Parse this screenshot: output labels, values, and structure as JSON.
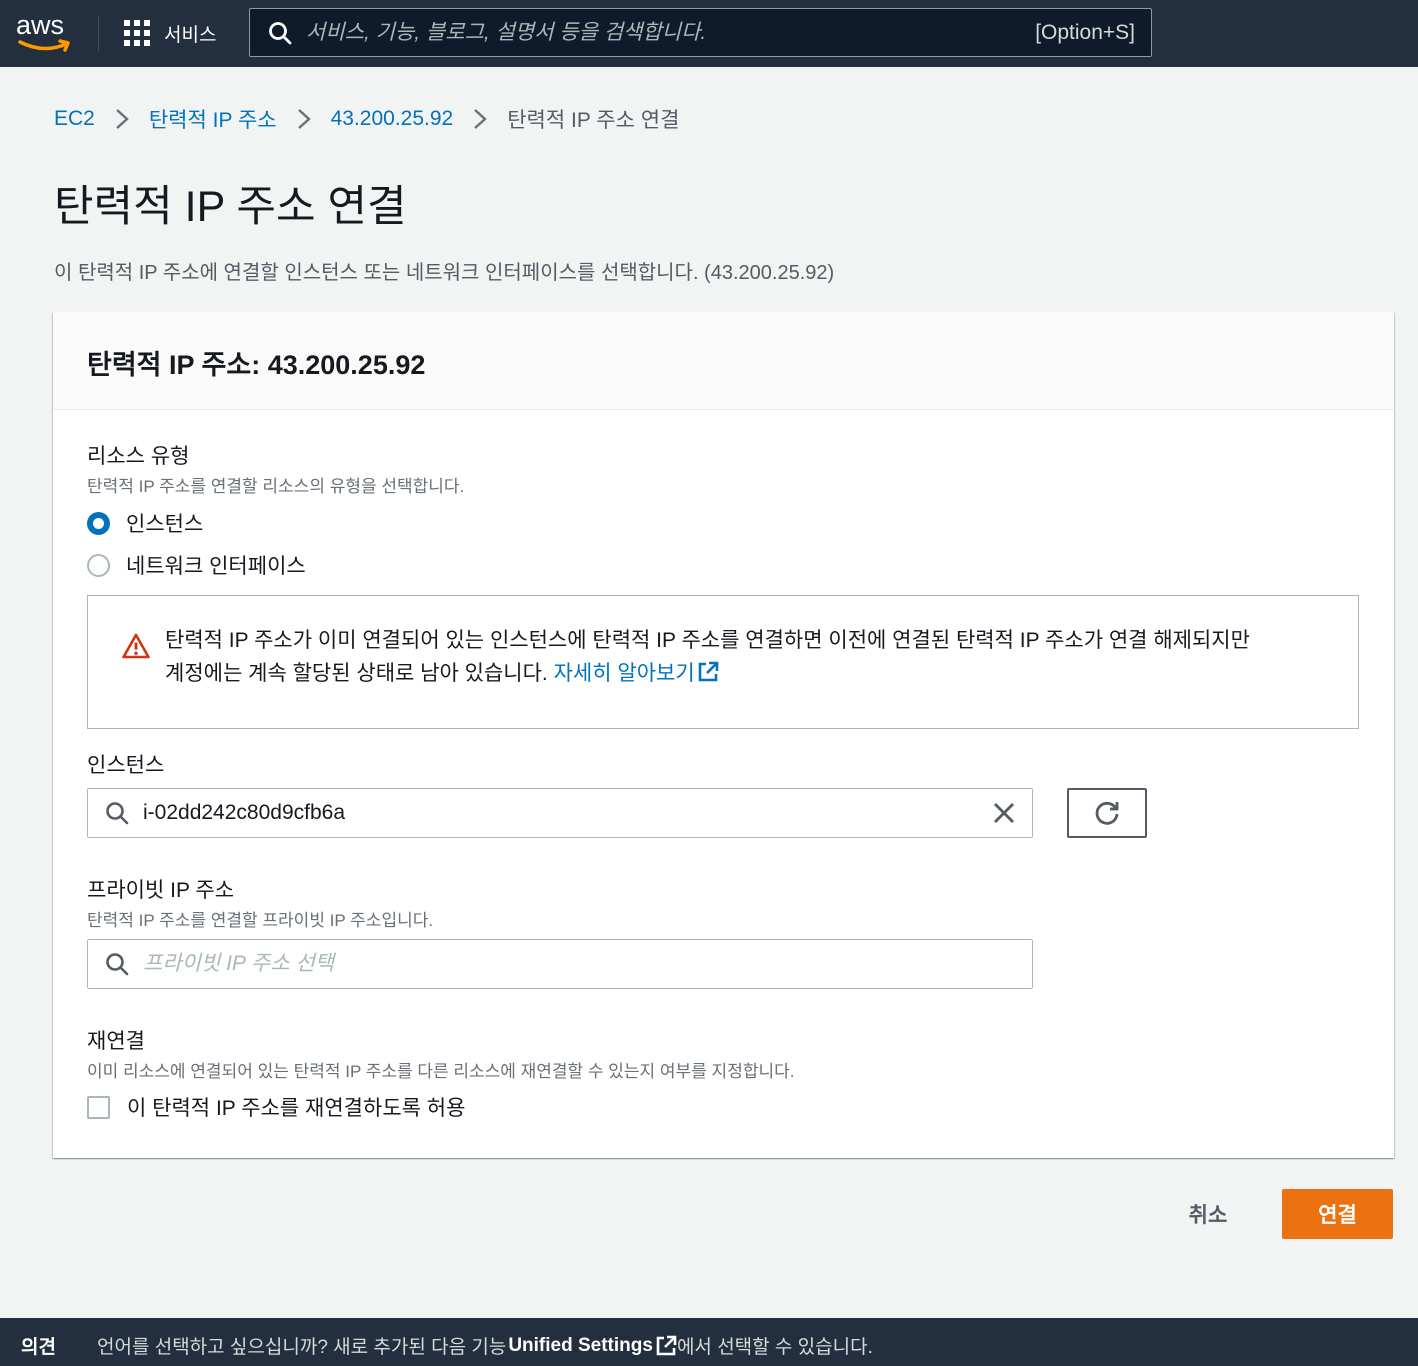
{
  "topnav": {
    "logo_text": "aws",
    "services_label": "서비스",
    "search_placeholder": "서비스, 기능, 블로그, 설명서 등을 검색합니다.",
    "search_shortcut": "[Option+S]"
  },
  "breadcrumb": {
    "items": [
      "EC2",
      "탄력적 IP 주소",
      "43.200.25.92"
    ],
    "current": "탄력적 IP 주소 연결"
  },
  "page": {
    "title": "탄력적 IP 주소 연결",
    "description": "이 탄력적 IP 주소에 연결할 인스턴스 또는 네트워크 인터페이스를 선택합니다. (43.200.25.92)"
  },
  "panel": {
    "header": "탄력적 IP 주소: 43.200.25.92",
    "resource_type": {
      "label": "리소스 유형",
      "description": "탄력적 IP 주소를 연결할 리소스의 유형을 선택합니다.",
      "options": [
        "인스턴스",
        "네트워크 인터페이스"
      ],
      "selected": "인스턴스"
    },
    "alert": {
      "line1": "탄력적 IP 주소가 이미 연결되어 있는 인스턴스에 탄력적 IP 주소를 연결하면 이전에 연결된 탄력적 IP 주소가 연결 해제되지만",
      "line2": "계정에는 계속 할당된 상태로 남아 있습니다. ",
      "link": "자세히 알아보기"
    },
    "instance": {
      "label": "인스턴스",
      "value": "i-02dd242c80d9cfb6a"
    },
    "private_ip": {
      "label": "프라이빗 IP 주소",
      "description": "탄력적 IP 주소를 연결할 프라이빗 IP 주소입니다.",
      "placeholder": "프라이빗 IP 주소 선택"
    },
    "reassociation": {
      "label": "재연결",
      "description": "이미 리소스에 연결되어 있는 탄력적 IP 주소를 다른 리소스에 재연결할 수 있는지 여부를 지정합니다.",
      "checkbox_label": "이 탄력적 IP 주소를 재연결하도록 허용",
      "checked": false
    }
  },
  "actions": {
    "cancel": "취소",
    "submit": "연결"
  },
  "footer": {
    "feedback": "의견",
    "message_prefix": "언어를 선택하고 싶으십니까? 새로 추가된 다음 기능",
    "link": "Unified Settings",
    "message_suffix": "에서 선택할 수 있습니다."
  },
  "colors": {
    "nav_bg": "#232f3e",
    "link": "#0073bb",
    "primary": "#ec7211",
    "warning": "#d13212"
  }
}
